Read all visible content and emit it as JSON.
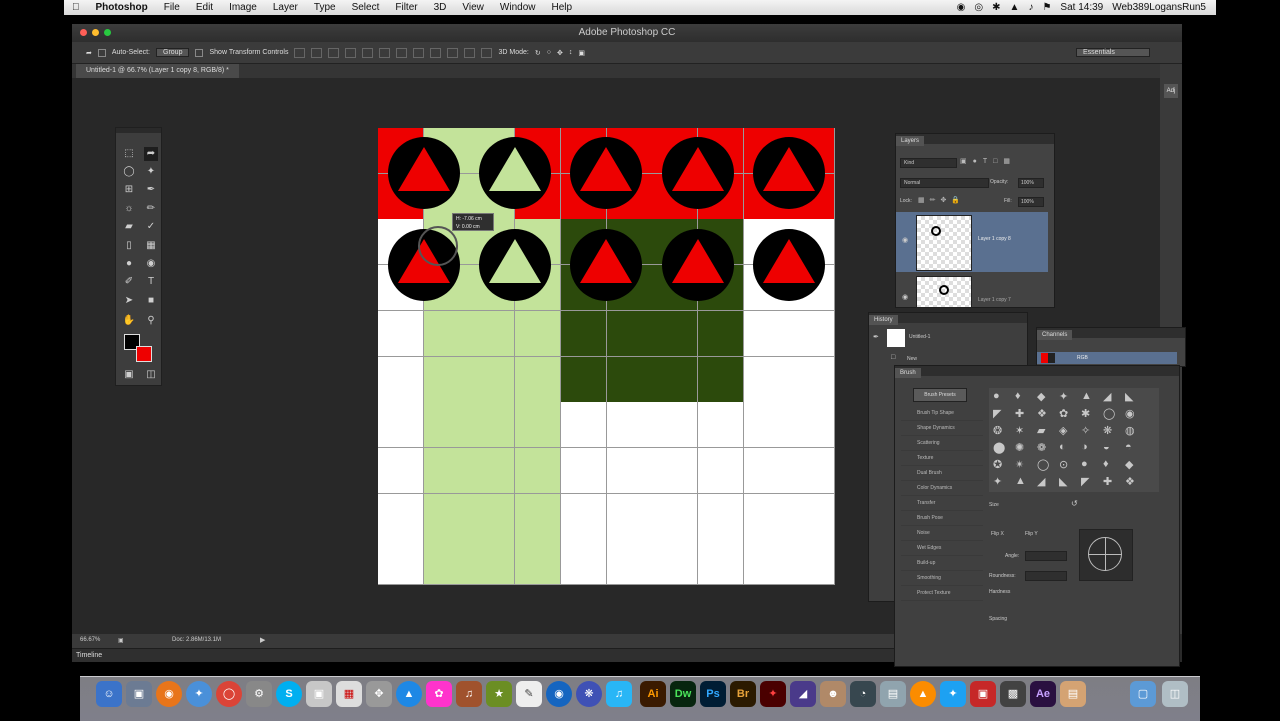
{
  "menubar": {
    "app": "Photoshop",
    "items": [
      "File",
      "Edit",
      "Image",
      "Layer",
      "Type",
      "Select",
      "Filter",
      "3D",
      "View",
      "Window",
      "Help"
    ],
    "clock": "Sat 14:39",
    "user": "Web389LogansRun5"
  },
  "window": {
    "title": "Adobe Photoshop CC"
  },
  "options_bar": {
    "auto_select_label": "Auto-Select:",
    "auto_select_value": "Group",
    "transform_label": "Show Transform Controls",
    "mode_3d": "3D Mode:",
    "workspace": "Essentials"
  },
  "document": {
    "tab_label": "Untitled-1 @ 66.7% (Layer 1 copy 8, RGB/8) *",
    "zoom": "66.67%",
    "doc_info": "Doc: 2.86M/13.1M"
  },
  "tooltip": {
    "line1": "H: -7.06 cm",
    "line2": "V: 0.00 cm"
  },
  "timeline_label": "Timeline",
  "colors": {
    "red": "#ee0000",
    "light_green": "#c3e39a",
    "dark_green": "#2c4a0c",
    "black": "#000000",
    "white": "#ffffff"
  },
  "layers_panel": {
    "tab": "Layers",
    "kind": "Kind",
    "blend": "Normal",
    "opacity_label": "Opacity:",
    "opacity_value": "100%",
    "lock_label": "Lock:",
    "fill_label": "Fill:",
    "fill_value": "100%",
    "selected_layer": "Layer 1 copy 8",
    "next_layer": "Layer 1 copy 7"
  },
  "history_panel": {
    "tab": "History",
    "items": [
      "Untitled-1",
      "New"
    ]
  },
  "channels_panel": {
    "tab": "Channels",
    "channel": "RGB"
  },
  "brush_panel": {
    "tab": "Brush",
    "presets_button": "Brush Presets",
    "options": [
      "Brush Tip Shape",
      "Shape Dynamics",
      "Scattering",
      "Texture",
      "Dual Brush",
      "Color Dynamics",
      "Transfer",
      "Brush Pose",
      "Noise",
      "Wet Edges",
      "Build-up",
      "Smoothing",
      "Protect Texture"
    ],
    "size_label": "Size",
    "flip_x": "Flip X",
    "flip_y": "Flip Y",
    "angle_label": "Angle:",
    "roundness_label": "Roundness:",
    "hardness_label": "Hardness",
    "spacing_label": "Spacing"
  },
  "dock": {
    "ai": "Ai",
    "dw": "Dw",
    "ps": "Ps",
    "br": "Br",
    "ae": "Ae"
  }
}
